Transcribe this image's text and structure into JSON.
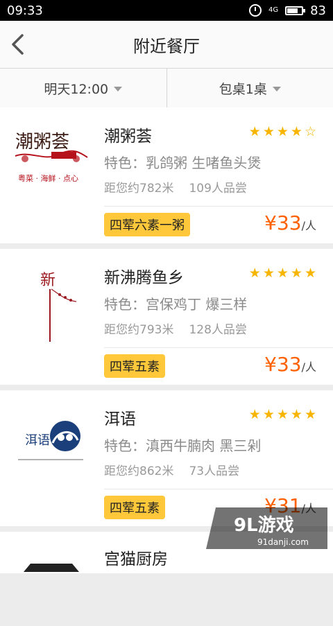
{
  "status_bar": {
    "time": "09:33",
    "network": "4G",
    "battery": "83"
  },
  "header": {
    "title": "附近餐厅"
  },
  "filters": [
    {
      "label": "明天12:00"
    },
    {
      "label": "包桌1桌"
    }
  ],
  "restaurants": [
    {
      "name": "潮粥荟",
      "rating": 4,
      "feature": "特色：乳鸽粥 生啫鱼头煲",
      "distance": "距您约782米",
      "tasted": "109人品尝",
      "tag": "四荤六素一粥",
      "price": "¥33",
      "unit": "/人",
      "logo_text": "潮粥荟",
      "logo_sub": "粤菜 · 海鲜 · 点心"
    },
    {
      "name": "新沸腾鱼乡",
      "rating": 5,
      "feature": "特色：宫保鸡丁 爆三样",
      "distance": "距您约793米",
      "tasted": "128人品尝",
      "tag": "四荤五素",
      "price": "¥33",
      "unit": "/人",
      "logo_text": "新"
    },
    {
      "name": "洱语",
      "rating": 5,
      "feature": "特色：滇西牛腩肉 黑三剁",
      "distance": "距您约862米",
      "tasted": "73人品尝",
      "tag": "四荤五素",
      "price": "¥31",
      "unit": "/人",
      "logo_text": "洱语"
    },
    {
      "name": "宫猫厨房"
    }
  ],
  "watermark": {
    "text": "9L游戏",
    "sub": "91danji.com"
  },
  "colors": {
    "accent": "#f7b500",
    "price": "#ff6000",
    "tag": "#ffc83a"
  }
}
